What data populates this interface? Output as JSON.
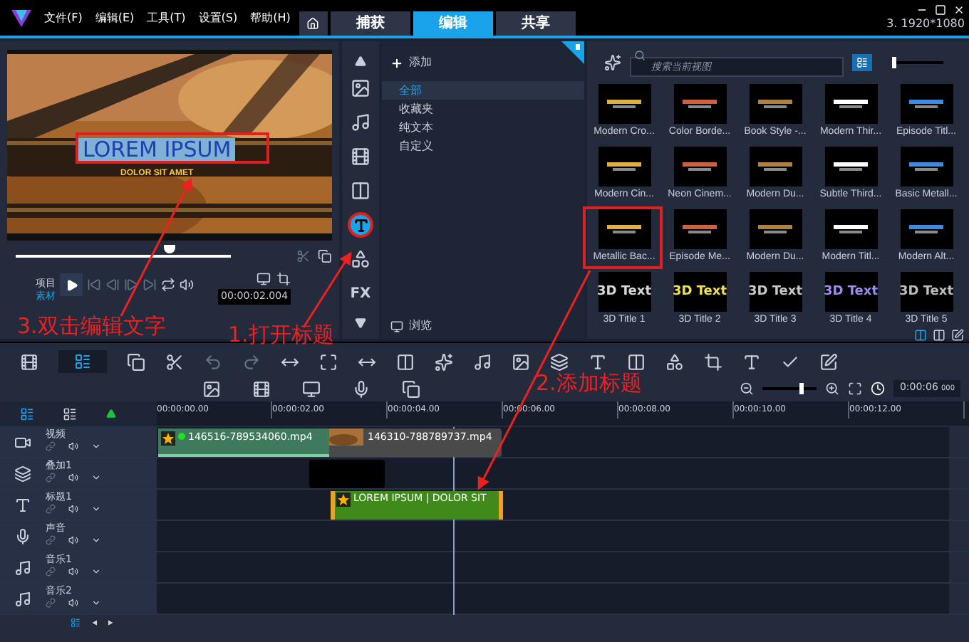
{
  "app": {
    "menu": [
      "文件(F)",
      "编辑(E)",
      "工具(T)",
      "设置(S)",
      "帮助(H)"
    ],
    "tabs": [
      {
        "label": "捕获",
        "selected": false
      },
      {
        "label": "编辑",
        "selected": true
      },
      {
        "label": "共享",
        "selected": false
      }
    ],
    "project_info": "3. 1920*1080"
  },
  "preview": {
    "title_text": "LOREM IPSUM",
    "subtitle_text": "DOLOR SIT AMET",
    "scrubber": {
      "level": 0.72
    },
    "modes": [
      {
        "label": "项目",
        "selected": false
      },
      {
        "label": "素材",
        "selected": true
      }
    ],
    "timecode": "00:00:02.004"
  },
  "tool_column": [
    {
      "kind": "media",
      "selected": false
    },
    {
      "kind": "audio",
      "selected": false
    },
    {
      "kind": "instant",
      "selected": false
    },
    {
      "kind": "transition",
      "selected": false
    },
    {
      "kind": "title",
      "selected": true
    },
    {
      "kind": "graphics",
      "selected": false
    },
    {
      "kind": "fx",
      "label": "FX",
      "selected": false
    }
  ],
  "library": {
    "add_label": "添加",
    "categories": [
      {
        "label": "全部",
        "selected": true
      },
      {
        "label": "收藏夹",
        "selected": false
      },
      {
        "label": "纯文本",
        "selected": false
      },
      {
        "label": "自定义",
        "selected": false
      }
    ],
    "browse_label": "浏览",
    "search_placeholder": "搜索当前视图",
    "size_slider": {
      "level": 0.05
    },
    "thumbnails": [
      {
        "label": "Modern Cro...",
        "kind": "style"
      },
      {
        "label": "Color Borde...",
        "kind": "style"
      },
      {
        "label": "Book Style -...",
        "kind": "style"
      },
      {
        "label": "Modern Thir...",
        "kind": "style"
      },
      {
        "label": "Episode Titl...",
        "kind": "style"
      },
      {
        "label": "Modern Cin...",
        "kind": "style"
      },
      {
        "label": "Neon Cinem...",
        "kind": "style"
      },
      {
        "label": "Modern Du...",
        "kind": "style"
      },
      {
        "label": "Subtle Third...",
        "kind": "style"
      },
      {
        "label": "Basic Metall...",
        "kind": "style"
      },
      {
        "label": "Metallic Bac...",
        "kind": "style"
      },
      {
        "label": "Episode Me...",
        "kind": "style"
      },
      {
        "label": "Modern Du...",
        "kind": "style"
      },
      {
        "label": "Modern Titl...",
        "kind": "style"
      },
      {
        "label": "Modern Alt...",
        "kind": "style"
      },
      {
        "label": "3D Title 1",
        "kind": "extruded",
        "thumb_text": "3D Text",
        "color": "#d8d8d8"
      },
      {
        "label": "3D Title 2",
        "kind": "extruded",
        "thumb_text": "3D Text",
        "color": "#f2e24a"
      },
      {
        "label": "3D Title 3",
        "kind": "extruded",
        "thumb_text": "3D Text",
        "color": "#c8c8c8"
      },
      {
        "label": "3D Title 4",
        "kind": "extruded",
        "thumb_text": "3D Text",
        "color": "#9a8cf0"
      },
      {
        "label": "3D Title 5",
        "kind": "extruded",
        "thumb_text": "3D Text",
        "color": "#bdbdbd"
      }
    ]
  },
  "timeline": {
    "zoom_slider": {
      "level": 0.7
    },
    "duration": "0:00:06",
    "duration_ms": "000",
    "ruler": [
      "00:00:00.00",
      "00:00:02.00",
      "00:00:04.00",
      "00:00:06.00",
      "00:00:08.00",
      "00:00:10.00",
      "00:00:12.00"
    ],
    "tracks": [
      {
        "name": "视频",
        "kind": "video",
        "clips": [
          {
            "label": "146516-789534060.mp4",
            "kind": "video"
          },
          {
            "label": "146310-788789737.mp4"
          }
        ]
      },
      {
        "name": "叠加1",
        "kind": "overlay",
        "clips": [
          {
            "kind": "black"
          }
        ]
      },
      {
        "name": "标题1",
        "kind": "title",
        "clips": [
          {
            "label": "LOREM IPSUM | DOLOR SIT",
            "kind": "title"
          }
        ]
      },
      {
        "name": "声音",
        "kind": "voice"
      },
      {
        "name": "音乐1",
        "kind": "music"
      },
      {
        "name": "音乐2",
        "kind": "music"
      }
    ]
  },
  "annotations": [
    {
      "text": "3.双击编辑文字"
    },
    {
      "text": "1.打开标题"
    },
    {
      "text": "2.添加标题"
    }
  ]
}
